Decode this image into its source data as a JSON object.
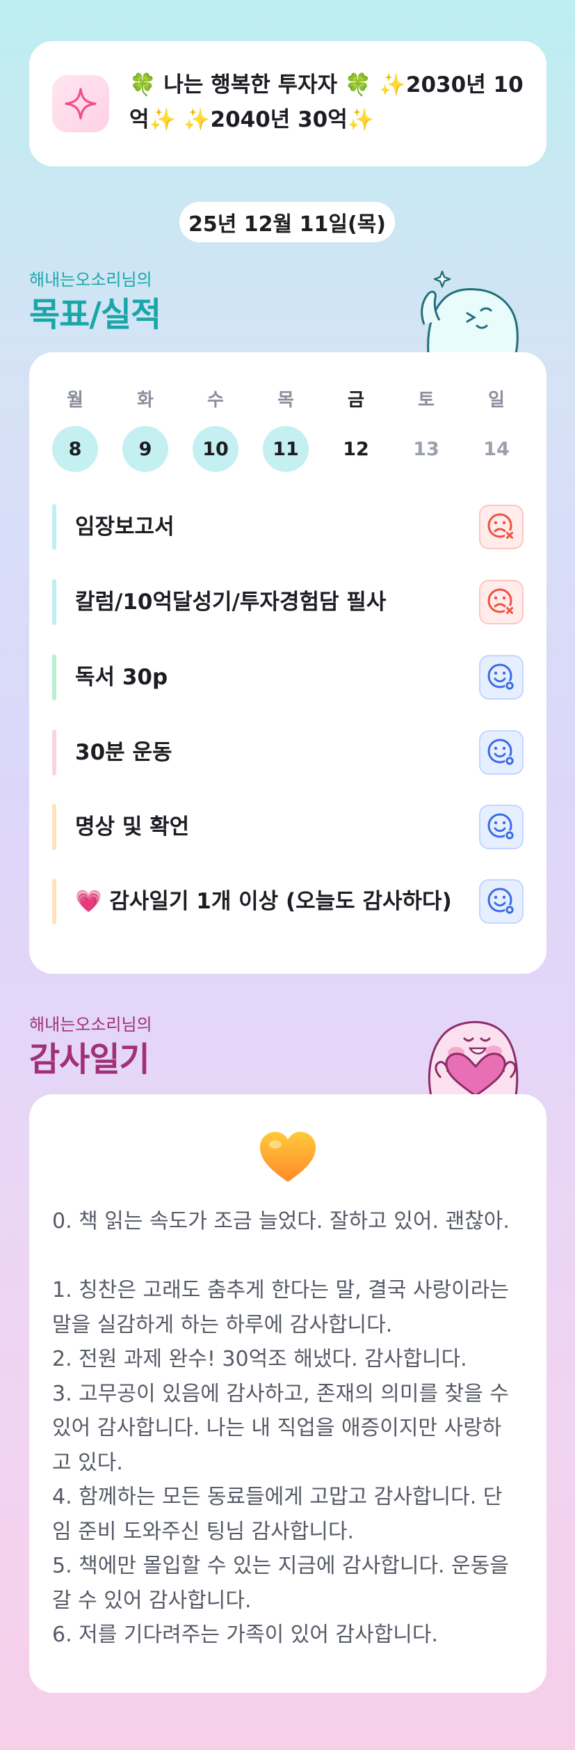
{
  "motto": {
    "line1": "🍀 나는 행복한 투자자 🍀  ✨2030년 10",
    "line2": "억✨  ✨2040년 30억✨"
  },
  "date": "25년 12월 11일(목)",
  "goals_section": {
    "subtitle": "해내는오소리님의",
    "title": "목표/실적"
  },
  "week": {
    "days": [
      {
        "label": "월",
        "num": "8",
        "state": "done"
      },
      {
        "label": "화",
        "num": "9",
        "state": "done"
      },
      {
        "label": "수",
        "num": "10",
        "state": "done"
      },
      {
        "label": "목",
        "num": "11",
        "state": "done"
      },
      {
        "label": "금",
        "num": "12",
        "state": "today"
      },
      {
        "label": "토",
        "num": "13",
        "state": "future"
      },
      {
        "label": "일",
        "num": "14",
        "state": "future"
      }
    ]
  },
  "goals": [
    {
      "text": "임장보고서",
      "status": "fail",
      "bar_color": "#bfeff2",
      "icon": "sad-x-icon"
    },
    {
      "text": "칼럼/10억달성기/투자경험담 필사",
      "status": "fail",
      "bar_color": "#bfeff2",
      "icon": "sad-x-icon"
    },
    {
      "text": "독서 30p",
      "status": "ok",
      "bar_color": "#b5f0d2",
      "icon": "smile-check-icon"
    },
    {
      "text": "30분 운동",
      "status": "ok",
      "bar_color": "#ffd1e6",
      "icon": "smile-check-icon"
    },
    {
      "text": "명상 및 확언",
      "status": "ok",
      "bar_color": "#ffe2bd",
      "icon": "smile-check-icon"
    },
    {
      "text": "💗 감사일기 1개 이상 (오늘도 감사하다)",
      "status": "ok",
      "bar_color": "#ffe2bd",
      "icon": "smile-check-icon"
    }
  ],
  "gratitude_section": {
    "subtitle": "해내는오소리님의",
    "title": "감사일기"
  },
  "gratitude": {
    "lines": [
      "0. 책 읽는 속도가 조금 늘었다. 잘하고 있어. 괜찮아.",
      "",
      "1. 칭찬은 고래도 춤추게 한다는 말, 결국 사랑이라는",
      "말을 실감하게 하는 하루에 감사합니다.",
      "2. 전원 과제 완수! 30억조 해냈다. 감사합니다.",
      "3. 고무공이 있음에 감사하고, 존재의 의미를 찾을 수",
      "있어 감사합니다. 나는 내 직업을 애증이지만 사랑하",
      "고 있다.",
      "4. 함께하는 모든 동료들에게 고맙고 감사합니다. 단",
      "임 준비 도와주신 팅님 감사합니다.",
      "5. 책에만 몰입할 수 있는 지금에 감사합니다. 운동을",
      "갈 수 있어 감사합니다.",
      "6. 저를 기다려주는 가족이 있어 감사합니다."
    ]
  },
  "colors": {
    "goals_title": "#1aa6a8",
    "gratitude_title": "#a12f7a",
    "fail": "#f0503f",
    "ok": "#3a6ae6"
  }
}
